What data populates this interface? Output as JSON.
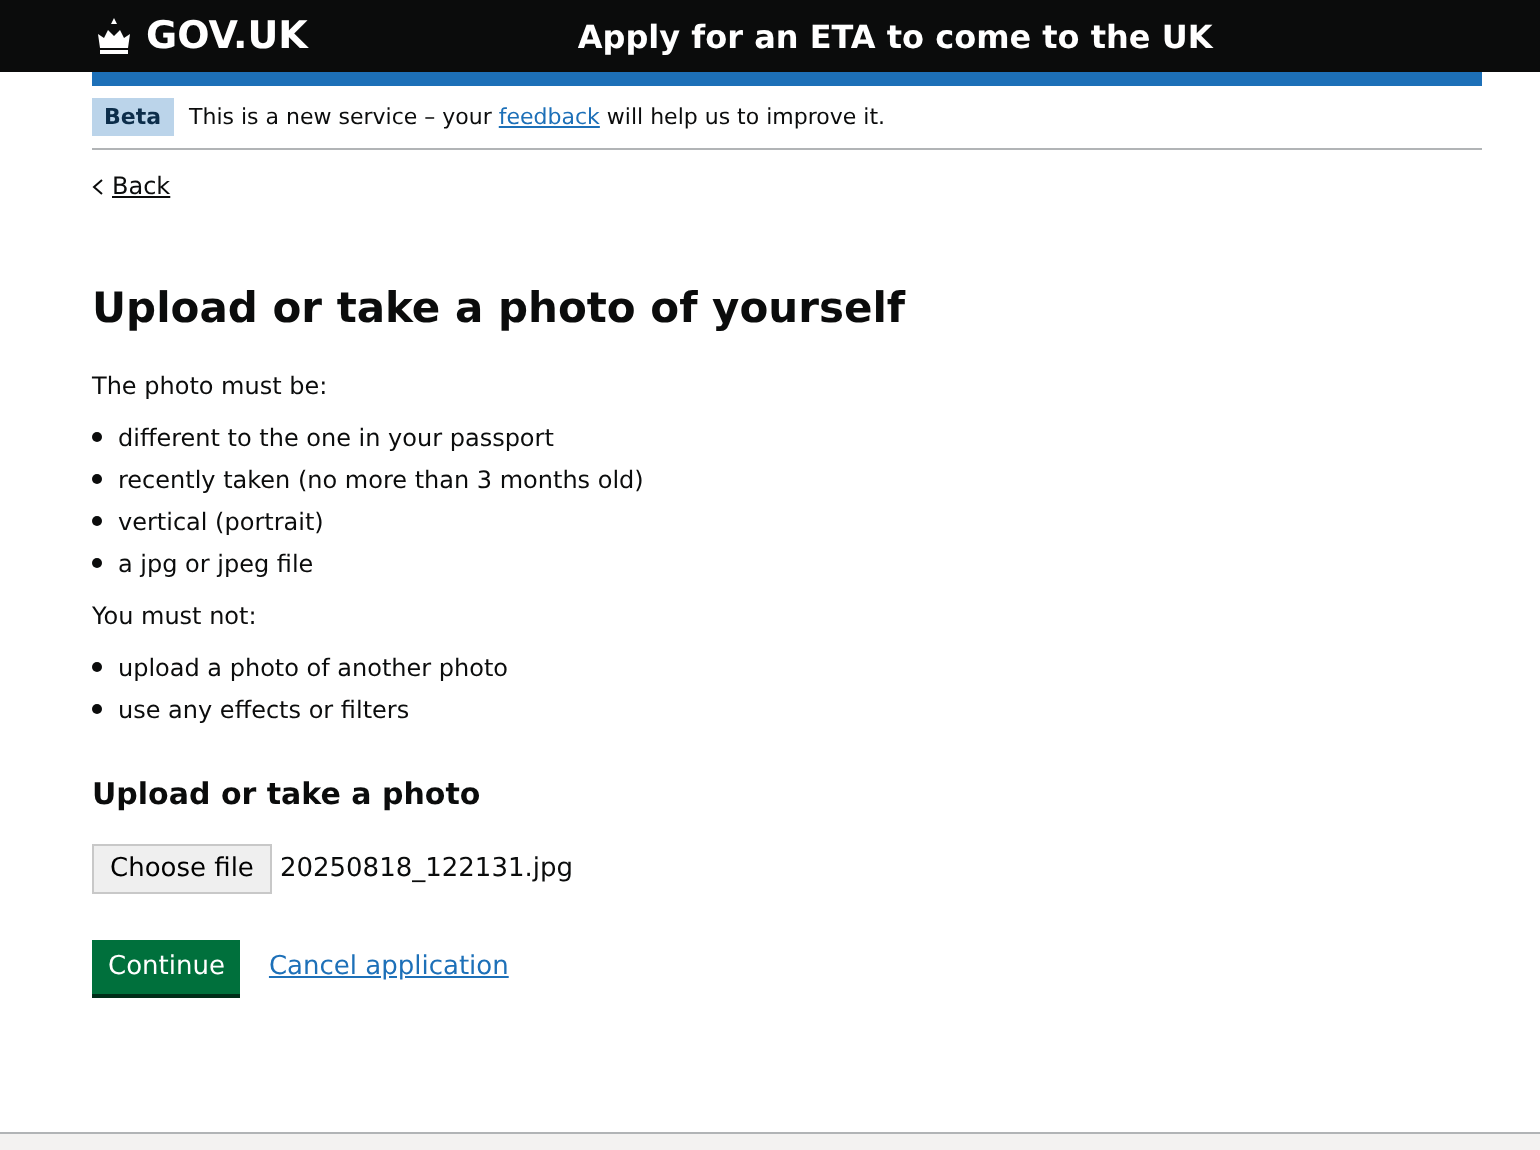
{
  "header": {
    "logo": "GOV.UK",
    "service_name": "Apply for an ETA to come to the UK"
  },
  "phase_banner": {
    "tag": "Beta",
    "text_before": "This is a new service – your",
    "link": "feedback",
    "text_after": "will help us to improve it."
  },
  "back_link": "Back",
  "heading": "Upload or take a photo of yourself",
  "sections": [
    {
      "intro": "The photo must be:",
      "items": [
        "different to the one in your passport",
        "recently taken (no more than 3 months old)",
        "vertical (portrait)",
        "a jpg or jpeg file"
      ]
    },
    {
      "intro": "You must not:",
      "items": [
        "upload a photo of another photo",
        "use any effects or filters"
      ]
    }
  ],
  "upload": {
    "label": "Upload or take a photo",
    "button": "Choose file",
    "file_name": "20250818_122131.jpg"
  },
  "actions": {
    "continue": "Continue",
    "cancel": "Cancel application"
  }
}
